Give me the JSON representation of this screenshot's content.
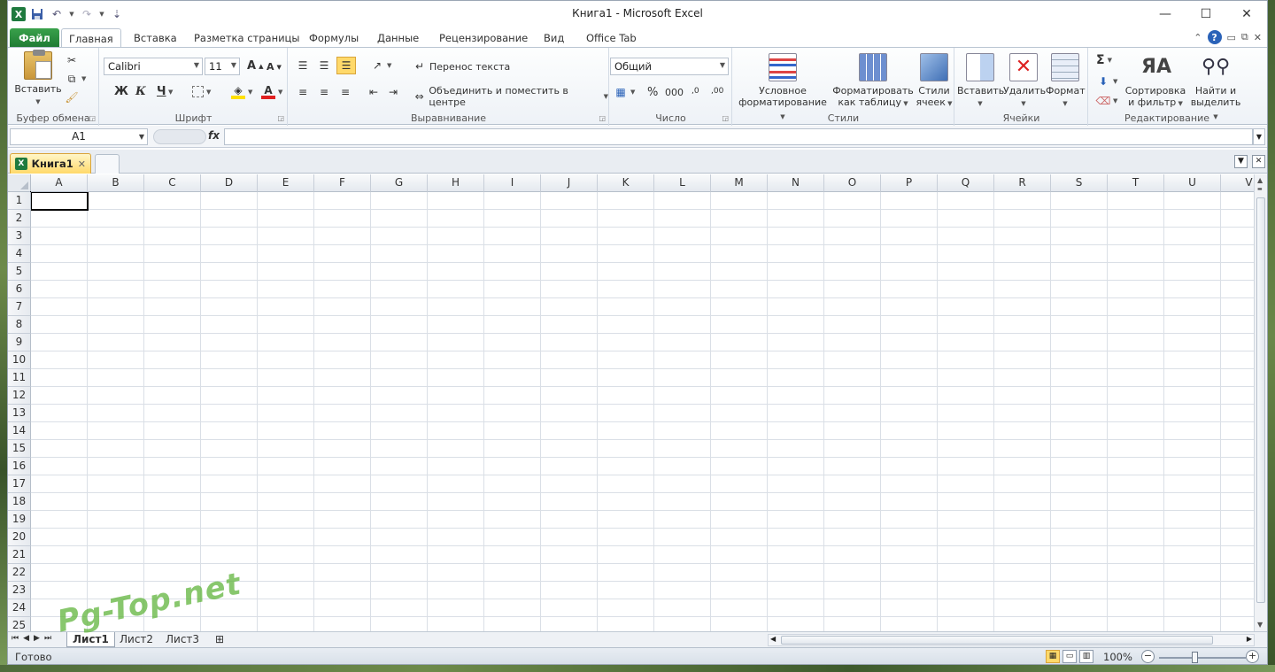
{
  "window": {
    "title": "Книга1 - Microsoft Excel",
    "qat": {
      "logo": "X",
      "save_icon": "save-icon",
      "undo_icon": "undo-icon",
      "redo_icon": "redo-icon",
      "customize_icon": "customize-icon"
    },
    "controls": {
      "minimize": "—",
      "maximize": "☐",
      "close": "✕"
    }
  },
  "ribbon_tabs": [
    {
      "label": "Файл"
    },
    {
      "label": "Главная"
    },
    {
      "label": "Вставка"
    },
    {
      "label": "Разметка страницы"
    },
    {
      "label": "Формулы"
    },
    {
      "label": "Данные"
    },
    {
      "label": "Рецензирование"
    },
    {
      "label": "Вид"
    },
    {
      "label": "Office Tab"
    }
  ],
  "ribbon": {
    "clipboard": {
      "label": "Буфер обмена",
      "paste": "Вставить"
    },
    "font": {
      "label": "Шрифт",
      "font_name": "Calibri",
      "font_size": "11",
      "bold": "Ж",
      "italic": "К",
      "underline": "Ч",
      "grow": "A",
      "shrink": "A",
      "font_color_letter": "A"
    },
    "alignment": {
      "label": "Выравнивание",
      "wrap": "Перенос текста",
      "merge": "Объединить и поместить в центре"
    },
    "number": {
      "label": "Число",
      "format": "Общий",
      "percent": "%",
      "thousands": "000",
      "inc_decimal": ",0",
      "dec_decimal": ",00"
    },
    "styles": {
      "label": "Стили",
      "conditional": [
        "Условное",
        "форматирование"
      ],
      "as_table": [
        "Форматировать",
        "как таблицу"
      ],
      "cell_styles": [
        "Стили",
        "ячеек"
      ]
    },
    "cells": {
      "label": "Ячейки",
      "insert": "Вставить",
      "delete": "Удалить",
      "format": "Формат"
    },
    "editing": {
      "label": "Редактирование",
      "sigma": "Σ",
      "sort": [
        "Сортировка",
        "и фильтр"
      ],
      "find": [
        "Найти и",
        "выделить"
      ]
    }
  },
  "formula_bar": {
    "name_box": "A1",
    "fx": "fx",
    "value": ""
  },
  "doc_tabs": [
    {
      "label": "Книга1"
    }
  ],
  "grid": {
    "columns": [
      "A",
      "B",
      "C",
      "D",
      "E",
      "F",
      "G",
      "H",
      "I",
      "J",
      "K",
      "L",
      "M",
      "N",
      "O",
      "P",
      "Q",
      "R",
      "S",
      "T",
      "U",
      "V"
    ],
    "rows": [
      "1",
      "2",
      "3",
      "4",
      "5",
      "6",
      "7",
      "8",
      "9",
      "10",
      "11",
      "12",
      "13",
      "14",
      "15",
      "16",
      "17",
      "18",
      "19",
      "20",
      "21",
      "22",
      "23",
      "24",
      "25"
    ],
    "active_cell": "A1"
  },
  "sheets": [
    {
      "label": "Лист1",
      "active": true
    },
    {
      "label": "Лист2",
      "active": false
    },
    {
      "label": "Лист3",
      "active": false
    }
  ],
  "status": {
    "text": "Готово",
    "zoom": "100%"
  },
  "watermark": "Pg-Top.net",
  "colors": {
    "file_tab": "#2a8c3e",
    "accent": "#1f7a3e",
    "active_highlight": "#ffd96a"
  }
}
